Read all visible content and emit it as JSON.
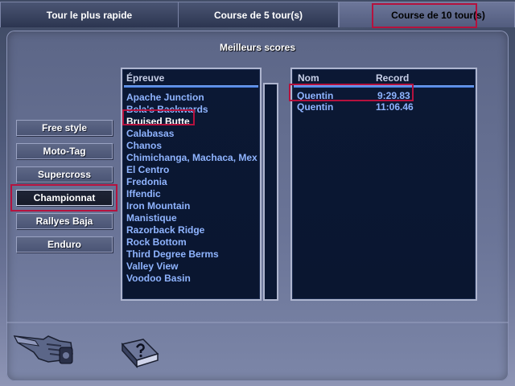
{
  "tabs": [
    {
      "label": "Tour le plus rapide"
    },
    {
      "label": "Course de 5 tour(s)"
    },
    {
      "label": "Course de 10 tour(s)"
    }
  ],
  "heading": "Meilleurs scores",
  "modes": [
    {
      "label": "Free style"
    },
    {
      "label": "Moto-Tag"
    },
    {
      "label": "Supercross"
    },
    {
      "label": "Championnat"
    },
    {
      "label": "Rallyes Baja"
    },
    {
      "label": "Enduro"
    }
  ],
  "tracks_panel": {
    "header": "Épreuve",
    "items": [
      "Apache Junction",
      "Bela's Backwards",
      "Bruised Butte",
      "Calabasas",
      "Chanos",
      "Chimichanga, Machaca, Mex",
      "El Centro",
      "Fredonia",
      "Iffendic",
      "Iron Mountain",
      "Manistique",
      "Razorback Ridge",
      "Rock Bottom",
      "Third Degree Berms",
      "Valley View",
      "Voodoo Basin"
    ]
  },
  "scores_panel": {
    "col_name": "Nom",
    "col_record": "Record",
    "rows": [
      {
        "name": "Quentin",
        "record": "9:29.83"
      },
      {
        "name": "Quentin",
        "record": "11:06.46"
      }
    ]
  },
  "colors": {
    "highlight": "#b5123e",
    "list_text": "#8fb4ff"
  },
  "icons": [
    "pointing-hand-icon",
    "help-book-icon"
  ]
}
